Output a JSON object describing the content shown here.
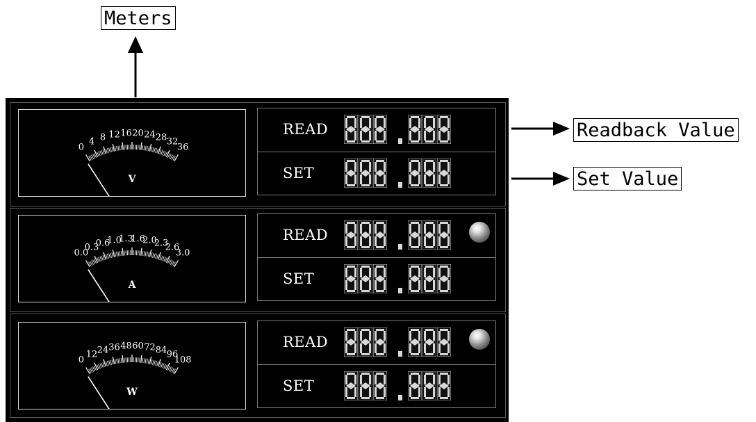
{
  "callouts": {
    "meters": "Meters",
    "readback": "Readback Value",
    "set": "Set Value"
  },
  "rows": [
    {
      "id": "voltage",
      "unit": "V",
      "scale": [
        "0",
        "4",
        "8",
        "12",
        "16",
        "20",
        "24",
        "28",
        "32",
        "36"
      ],
      "read_label": "READ",
      "set_label": "SET",
      "read_indicator": false
    },
    {
      "id": "current",
      "unit": "A",
      "scale": [
        "0.0",
        "0.3",
        "0.6",
        "1.0",
        "1.3",
        "1.6",
        "2.0",
        "2.3",
        "2.6",
        "3.0"
      ],
      "read_label": "READ",
      "set_label": "SET",
      "read_indicator": true
    },
    {
      "id": "power",
      "unit": "W",
      "scale": [
        "0",
        "12",
        "24",
        "36",
        "48",
        "60",
        "72",
        "84",
        "96",
        "108"
      ],
      "read_label": "READ",
      "set_label": "SET",
      "read_indicator": true
    }
  ],
  "colors": {
    "panel": "#000000",
    "digit_fill": "#d8d8d8",
    "meter_text": "#ffffff"
  }
}
